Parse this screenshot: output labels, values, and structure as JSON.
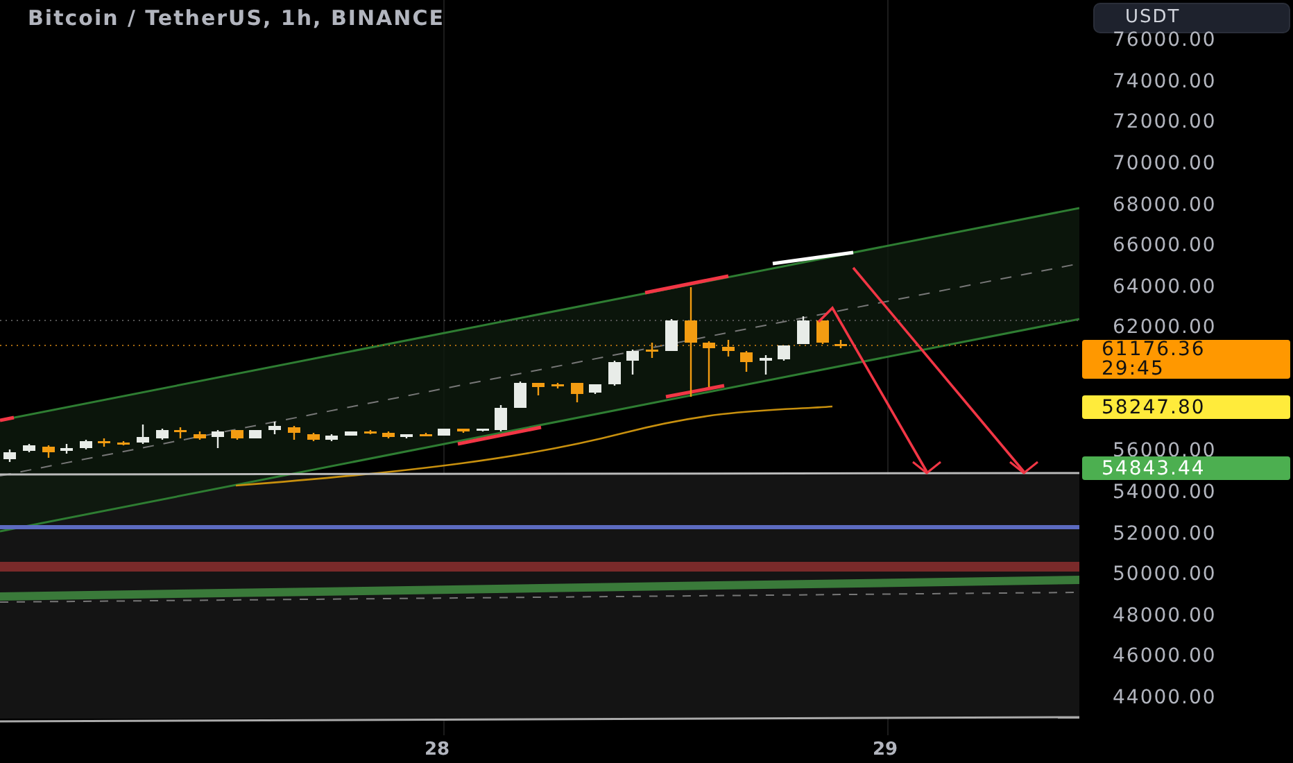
{
  "title": "Bitcoin / TetherUS, 1h, BINANCE",
  "currency_button": "USDT",
  "price_axis": {
    "ticks": [
      "76000.00",
      "74000.00",
      "72000.00",
      "70000.00",
      "68000.00",
      "66000.00",
      "64000.00",
      "62000.00",
      "56000.00",
      "54000.00",
      "52000.00",
      "50000.00",
      "48000.00",
      "46000.00",
      "44000.00"
    ]
  },
  "price_labels": [
    {
      "kind": "last_price",
      "label": "61176.36",
      "countdown": "29:45",
      "color": "#ff9800"
    },
    {
      "kind": "indicator",
      "label": "58247.80",
      "color": "#ffeb3b"
    },
    {
      "kind": "line",
      "label": "54843.44",
      "color": "#4caf50"
    }
  ],
  "time_axis": [
    "28",
    "29"
  ]
}
